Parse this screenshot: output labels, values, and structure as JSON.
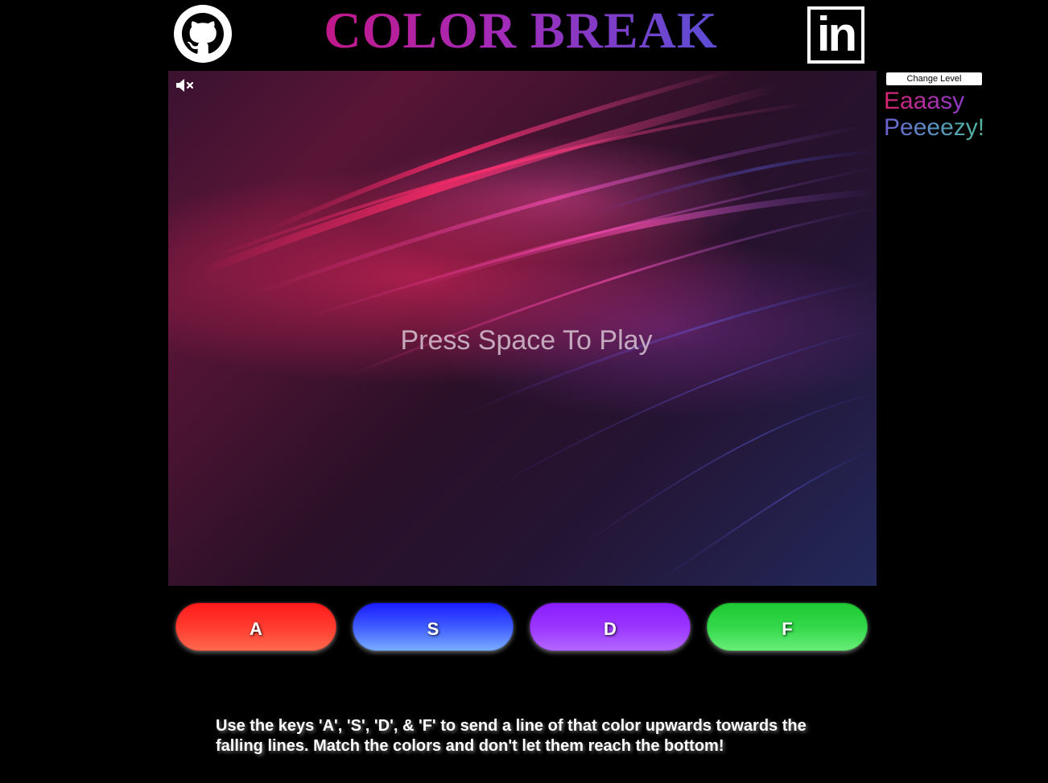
{
  "header": {
    "title": "COLOR BREAK",
    "github_icon": "github-icon",
    "linkedin_icon": "linkedin-icon",
    "linkedin_text": "in"
  },
  "game": {
    "mute_icon": "speaker-muted-icon",
    "prompt": "Press Space To Play"
  },
  "levels": {
    "change_label": "Change Level",
    "options": [
      {
        "label": "Eaaasy"
      },
      {
        "label": "Peeeezy!"
      }
    ]
  },
  "keys": [
    {
      "label": "A",
      "color": "#ff2a20"
    },
    {
      "label": "S",
      "color": "#2a3cff"
    },
    {
      "label": "D",
      "color": "#9a35ff"
    },
    {
      "label": "F",
      "color": "#2fd646"
    }
  ],
  "instructions": "Use the keys 'A', 'S', 'D', & 'F' to send a line of that color upwards towards the falling lines. Match the colors and don't let them reach the bottom!"
}
